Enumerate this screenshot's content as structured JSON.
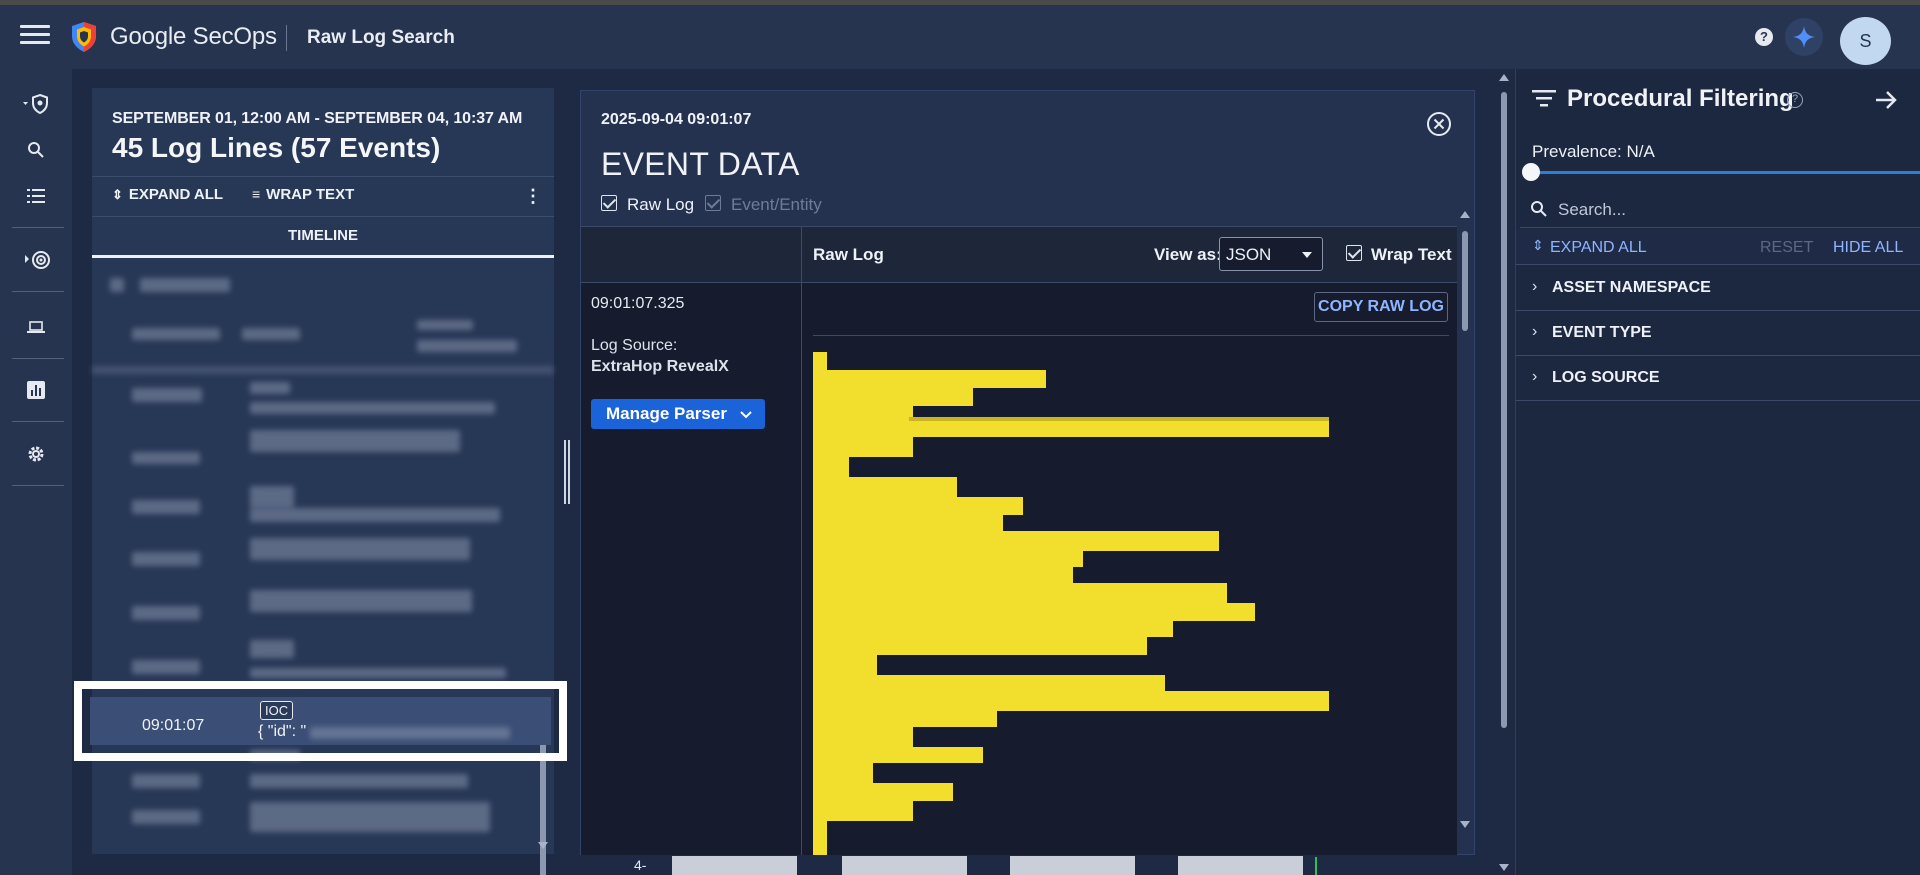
{
  "header": {
    "logo_text": "Google SecOps",
    "page_title": "Raw Log Search",
    "help_label": "?",
    "avatar_initial": "S"
  },
  "left_panel": {
    "date_range": "SEPTEMBER 01, 12:00 AM - SEPTEMBER 04, 10:37 AM",
    "summary": "45 Log Lines (57 Events)",
    "expand_all": "EXPAND ALL",
    "wrap_text": "WRAP TEXT",
    "tab": "TIMELINE",
    "selected_row": {
      "time": "09:01:07",
      "badge": "IOC",
      "preview": "{ \"id\": \""
    }
  },
  "event_panel": {
    "timestamp": "2025-09-04 09:01:07",
    "title": "EVENT DATA",
    "raw_log_checkbox": "Raw Log",
    "entity_checkbox": "Event/Entity",
    "raw_log_header": "Raw Log",
    "view_as_label": "View as:",
    "view_as_value": "JSON",
    "wrap_text_label": "Wrap Text",
    "event_time": "09:01:07.325",
    "log_source_label": "Log Source:",
    "log_source_value": "ExtraHop RevealX",
    "manage_parser": "Manage Parser",
    "copy_raw_log": "COPY RAW LOG"
  },
  "bottom_strip": {
    "number": "4-"
  },
  "right_panel": {
    "title": "Procedural Filtering",
    "help": "?",
    "prevalence": "Prevalence: N/A",
    "search_placeholder": "Search...",
    "expand_all": "EXPAND ALL",
    "reset": "RESET",
    "hide_all": "HIDE ALL",
    "facets": [
      "ASSET NAMESPACE",
      "EVENT TYPE",
      "LOG SOURCE"
    ]
  },
  "colors": {
    "accent_blue": "#1a63d8",
    "link_blue": "#8fb5ff",
    "redaction_yellow": "#f1de2d",
    "header_bg": "#26344f"
  },
  "icons": {
    "menu": "hamburger-icon",
    "logo": "secops-shield-icon",
    "gemini": "sparkle-icon",
    "close": "close-circle-icon",
    "filter": "filter-lines-icon",
    "collapse": "arrow-right-icon",
    "search": "search-icon"
  }
}
